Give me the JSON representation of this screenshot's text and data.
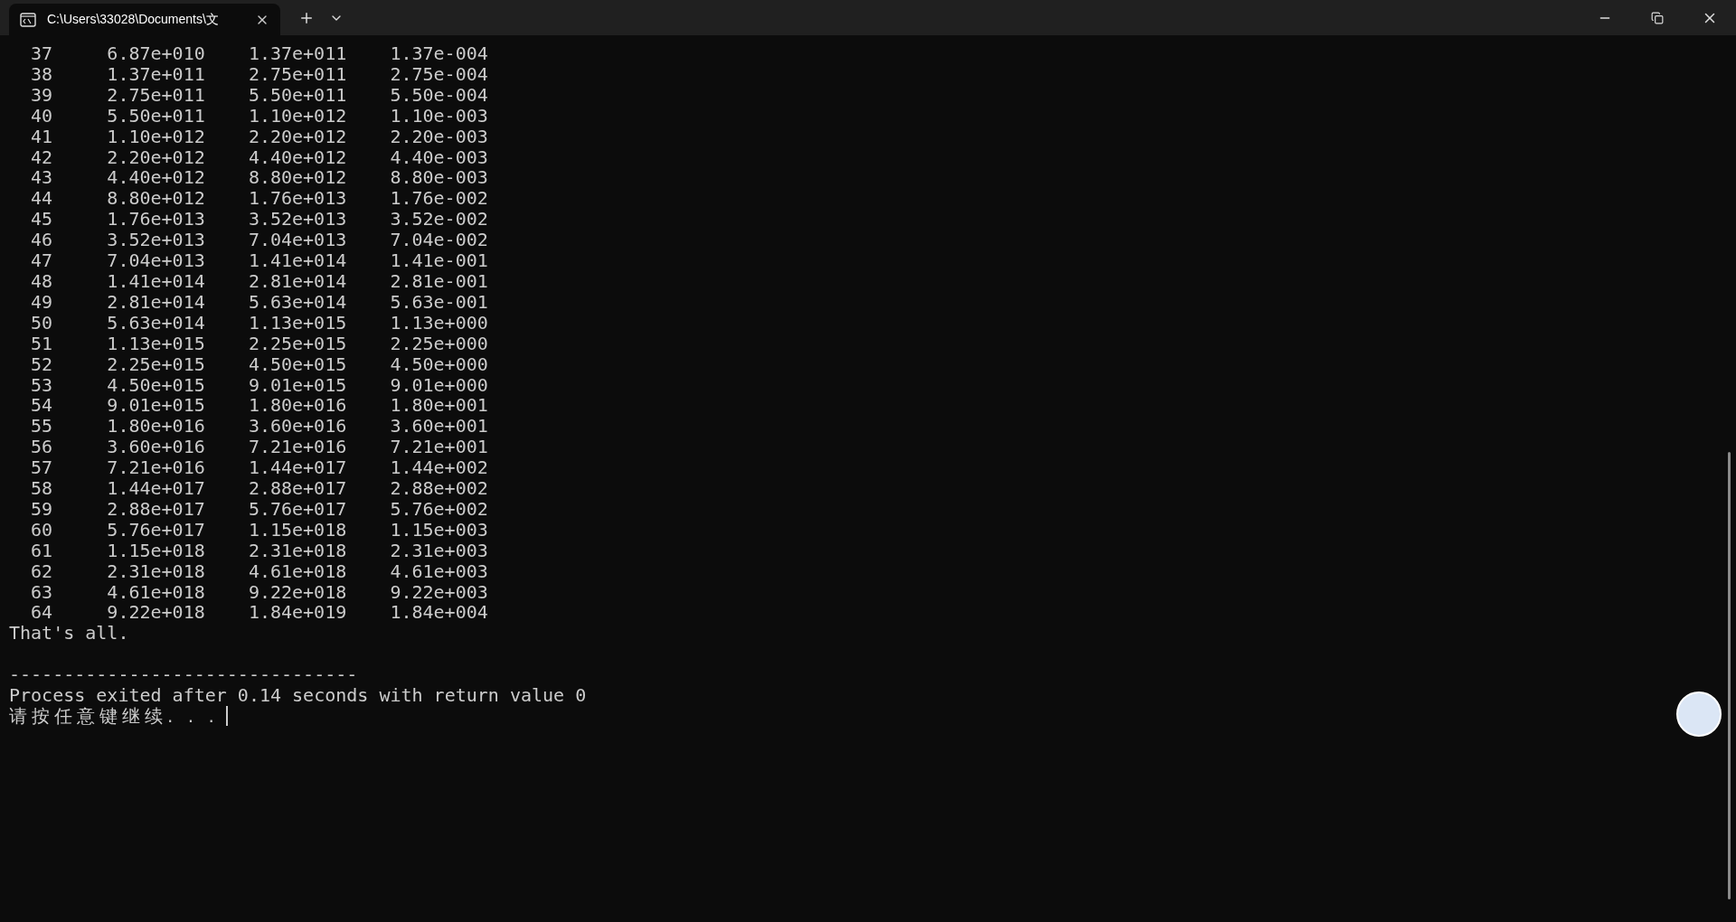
{
  "window": {
    "tab": {
      "title": "C:\\Users\\33028\\Documents\\文",
      "selected": true
    }
  },
  "rows": [
    [
      "37",
      "6.87e+010",
      "1.37e+011",
      "1.37e-004"
    ],
    [
      "38",
      "1.37e+011",
      "2.75e+011",
      "2.75e-004"
    ],
    [
      "39",
      "2.75e+011",
      "5.50e+011",
      "5.50e-004"
    ],
    [
      "40",
      "5.50e+011",
      "1.10e+012",
      "1.10e-003"
    ],
    [
      "41",
      "1.10e+012",
      "2.20e+012",
      "2.20e-003"
    ],
    [
      "42",
      "2.20e+012",
      "4.40e+012",
      "4.40e-003"
    ],
    [
      "43",
      "4.40e+012",
      "8.80e+012",
      "8.80e-003"
    ],
    [
      "44",
      "8.80e+012",
      "1.76e+013",
      "1.76e-002"
    ],
    [
      "45",
      "1.76e+013",
      "3.52e+013",
      "3.52e-002"
    ],
    [
      "46",
      "3.52e+013",
      "7.04e+013",
      "7.04e-002"
    ],
    [
      "47",
      "7.04e+013",
      "1.41e+014",
      "1.41e-001"
    ],
    [
      "48",
      "1.41e+014",
      "2.81e+014",
      "2.81e-001"
    ],
    [
      "49",
      "2.81e+014",
      "5.63e+014",
      "5.63e-001"
    ],
    [
      "50",
      "5.63e+014",
      "1.13e+015",
      "1.13e+000"
    ],
    [
      "51",
      "1.13e+015",
      "2.25e+015",
      "2.25e+000"
    ],
    [
      "52",
      "2.25e+015",
      "4.50e+015",
      "4.50e+000"
    ],
    [
      "53",
      "4.50e+015",
      "9.01e+015",
      "9.01e+000"
    ],
    [
      "54",
      "9.01e+015",
      "1.80e+016",
      "1.80e+001"
    ],
    [
      "55",
      "1.80e+016",
      "3.60e+016",
      "3.60e+001"
    ],
    [
      "56",
      "3.60e+016",
      "7.21e+016",
      "7.21e+001"
    ],
    [
      "57",
      "7.21e+016",
      "1.44e+017",
      "1.44e+002"
    ],
    [
      "58",
      "1.44e+017",
      "2.88e+017",
      "2.88e+002"
    ],
    [
      "59",
      "2.88e+017",
      "5.76e+017",
      "5.76e+002"
    ],
    [
      "60",
      "5.76e+017",
      "1.15e+018",
      "1.15e+003"
    ],
    [
      "61",
      "1.15e+018",
      "2.31e+018",
      "2.31e+003"
    ],
    [
      "62",
      "2.31e+018",
      "4.61e+018",
      "4.61e+003"
    ],
    [
      "63",
      "4.61e+018",
      "9.22e+018",
      "9.22e+003"
    ],
    [
      "64",
      "9.22e+018",
      "1.84e+019",
      "1.84e+004"
    ]
  ],
  "summary": "That's all.",
  "after": [
    "--------------------------------",
    "Process exited after 0.14 seconds with return value 0"
  ],
  "prompt": "请按任意键继续. . ."
}
